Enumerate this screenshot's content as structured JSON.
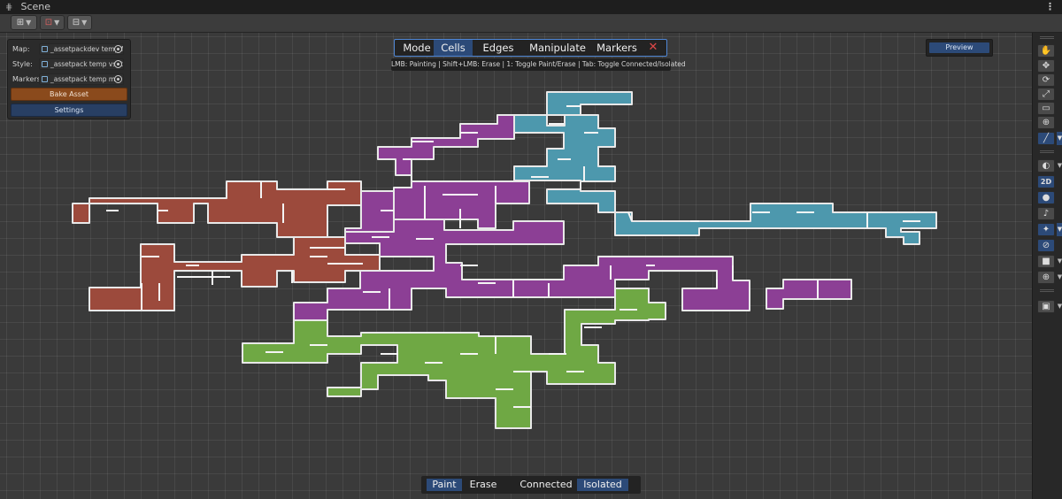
{
  "window": {
    "title": "Scene",
    "menu_glyph": "⋮"
  },
  "toolbar": {
    "buttons": [
      {
        "name": "gizmo-toggle",
        "icon": "grid-move-icon",
        "glyph": "⊞"
      },
      {
        "name": "snap-toggle",
        "icon": "snap-icon",
        "glyph": "⊡"
      },
      {
        "name": "increment-snap",
        "icon": "increment-icon",
        "glyph": "⊟"
      }
    ]
  },
  "panel": {
    "map_label": "Map:",
    "map_value": "_assetpackdev temp fi",
    "style_label": "Style:",
    "style_value": "_assetpack temp vsett",
    "markers_label": "Markers:",
    "markers_value": "_assetpack temp m",
    "bake_label": "Bake Asset",
    "settings_label": "Settings",
    "bake_color": "#8a4a1c",
    "settings_color": "#283f63"
  },
  "mode_bar": {
    "mode_label": "Mode",
    "cells": "Cells",
    "edges": "Edges",
    "manipulate": "Manipulate",
    "markers": "Markers",
    "close": "✕",
    "selected": "Cells"
  },
  "hint": "LMB: Painting | Shift+LMB: Erase | 1: Toggle Paint/Erase | Tab: Toggle Connected/Isolated",
  "preview": "Preview",
  "bottom_bar": {
    "paint": "Paint",
    "erase": "Erase",
    "connected": "Connected",
    "isolated": "Isolated",
    "selected": [
      "Paint",
      "Isolated"
    ]
  },
  "right_tools": {
    "hand_icon": "✋",
    "move_icon": "✥",
    "rotate_icon": "⟳",
    "scale_icon": "⤢",
    "rect_icon": "▭",
    "transform_icon": "⊕",
    "brush_icon": "╱",
    "shading_icon": "◐",
    "twod_label": "2D",
    "light_icon": "●",
    "audio_icon": "♪",
    "effects_icon": "✦",
    "hidden_icon": "⊘",
    "camera_icon": "■",
    "gizmo_icon": "⊕",
    "save_icon": "▣"
  },
  "colors": {
    "red_region": "#9c4a3c",
    "purple_region": "#8c3f95",
    "cyan_region": "#4d98ad",
    "green_region": "#6fa844",
    "outline": "#e8e8e8",
    "accent_blue": "#2c4a78"
  },
  "map": {
    "regions": [
      "red",
      "purple",
      "cyan",
      "green"
    ]
  }
}
